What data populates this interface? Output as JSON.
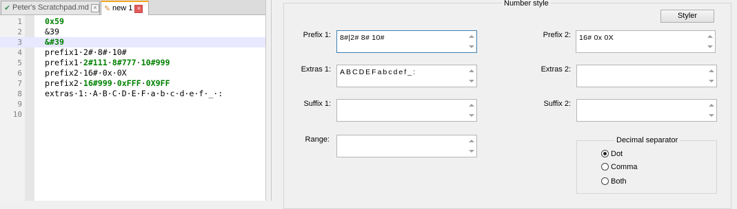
{
  "tabs": [
    {
      "label": "Peter's Scratchpad.md",
      "icon": "saved-check-icon",
      "active": false
    },
    {
      "label": "new 1",
      "icon": "pencil-icon",
      "active": true
    }
  ],
  "editor": {
    "current_line": 3,
    "lines": [
      {
        "n": "1",
        "segments": [
          {
            "t": "0x59",
            "c": "num"
          }
        ]
      },
      {
        "n": "2",
        "segments": [
          {
            "t": "&39",
            "c": "plain"
          }
        ]
      },
      {
        "n": "3",
        "segments": [
          {
            "t": "&#39",
            "c": "num"
          }
        ]
      },
      {
        "n": "4",
        "segments": [
          {
            "t": "prefix1·2#·8#·10#",
            "c": "plain"
          }
        ]
      },
      {
        "n": "5",
        "segments": [
          {
            "t": "prefix1·",
            "c": "plain"
          },
          {
            "t": "2#111",
            "c": "num"
          },
          {
            "t": "·",
            "c": "plain"
          },
          {
            "t": "8#777",
            "c": "num"
          },
          {
            "t": "·",
            "c": "plain"
          },
          {
            "t": "10#999",
            "c": "num"
          }
        ]
      },
      {
        "n": "6",
        "segments": [
          {
            "t": "prefix2·16#·0x·0X",
            "c": "plain"
          }
        ]
      },
      {
        "n": "7",
        "segments": [
          {
            "t": "prefix2·",
            "c": "plain"
          },
          {
            "t": "16#999",
            "c": "num"
          },
          {
            "t": "·",
            "c": "plain"
          },
          {
            "t": "0xFFF",
            "c": "num"
          },
          {
            "t": "·",
            "c": "plain"
          },
          {
            "t": "0X9FF",
            "c": "num"
          }
        ]
      },
      {
        "n": "8",
        "segments": [
          {
            "t": "extras·1:·A·B·C·D·E·F·a·b·c·d·e·f·_·:",
            "c": "plain"
          }
        ]
      },
      {
        "n": "9",
        "segments": []
      },
      {
        "n": "10",
        "segments": []
      }
    ]
  },
  "dialog": {
    "group_title": "Number style",
    "styler_button": "Styler",
    "prefix1": {
      "label": "Prefix 1:",
      "value": "8#|2# 8# 10#"
    },
    "prefix2": {
      "label": "Prefix 2:",
      "value": "16# 0x 0X"
    },
    "extras1": {
      "label": "Extras 1:",
      "value": "ABCDEFabcdef_:"
    },
    "extras2": {
      "label": "Extras 2:",
      "value": ""
    },
    "suffix1": {
      "label": "Suffix 1:",
      "value": ""
    },
    "suffix2": {
      "label": "Suffix 2:",
      "value": ""
    },
    "range": {
      "label": "Range:",
      "value": ""
    },
    "decimal_separator": {
      "title": "Decimal separator",
      "options": [
        {
          "label": "Dot",
          "checked": true
        },
        {
          "label": "Comma",
          "checked": false
        },
        {
          "label": "Both",
          "checked": false
        }
      ]
    }
  }
}
